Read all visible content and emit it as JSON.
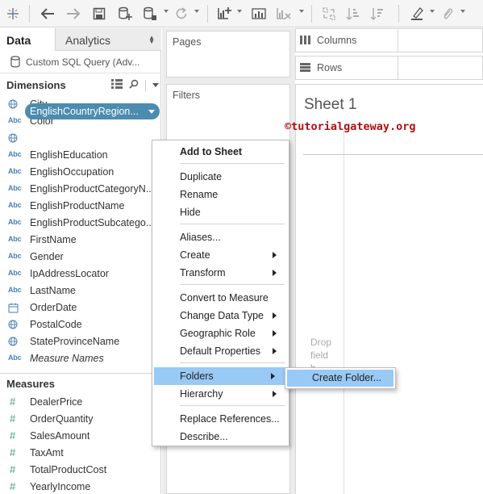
{
  "toolbar": {
    "buttons": [
      "tableau-logo-icon",
      "back-icon",
      "forward-icon",
      "save-icon",
      "new-datasource-icon",
      "datasource-icon",
      "refresh-icon",
      "new-worksheet-icon",
      "new-chart-icon",
      "clear-sheet-icon",
      "swap-icon",
      "sort-ascending-icon",
      "sort-descending-icon",
      "highlight-icon",
      "attach-icon"
    ]
  },
  "left_pane": {
    "tabs": {
      "data": "Data",
      "analytics": "Analytics"
    },
    "datasource": "Custom SQL Query (Adv...",
    "dimensions_header": "Dimensions",
    "dimensions": [
      {
        "type": "geo",
        "name": "City"
      },
      {
        "type": "Abc",
        "name": "Color"
      },
      {
        "type": "geo",
        "name": "EnglishCountryRegion...",
        "selected": true
      },
      {
        "type": "Abc",
        "name": "EnglishEducation"
      },
      {
        "type": "Abc",
        "name": "EnglishOccupation"
      },
      {
        "type": "Abc",
        "name": "EnglishProductCategoryN..."
      },
      {
        "type": "Abc",
        "name": "EnglishProductName"
      },
      {
        "type": "Abc",
        "name": "EnglishProductSubcatego..."
      },
      {
        "type": "Abc",
        "name": "FirstName"
      },
      {
        "type": "Abc",
        "name": "Gender"
      },
      {
        "type": "Abc",
        "name": "IpAddressLocator"
      },
      {
        "type": "Abc",
        "name": "LastName"
      },
      {
        "type": "date",
        "name": "OrderDate"
      },
      {
        "type": "geo",
        "name": "PostalCode"
      },
      {
        "type": "geo",
        "name": "StateProvinceName"
      },
      {
        "type": "Abc",
        "name": "Measure Names"
      }
    ],
    "measures_header": "Measures",
    "measures": [
      "DealerPrice",
      "OrderQuantity",
      "SalesAmount",
      "TaxAmt",
      "TotalProductCost",
      "YearlyIncome"
    ],
    "type_labels": {
      "abc": "Abc",
      "measure": "#"
    }
  },
  "cards": {
    "pages": "Pages",
    "filters": "Filters"
  },
  "shelves": {
    "columns": "Columns",
    "rows": "Rows"
  },
  "canvas": {
    "sheet_title": "Sheet 1",
    "watermark": "©tutorialgateway.org",
    "drop_hint_1": "Drop",
    "drop_hint_2": "field",
    "drop_hint_3": "h"
  },
  "context_menu": {
    "items": [
      "Add to Sheet",
      "Duplicate",
      "Rename",
      "Hide",
      "Aliases...",
      "Create",
      "Transform",
      "Convert to Measure",
      "Change Data Type",
      "Geographic Role",
      "Default Properties",
      "Folders",
      "Hierarchy",
      "Replace References...",
      "Describe..."
    ],
    "submenu_item": "Create Folder..."
  },
  "colors": {
    "pill": "#4b8cb0",
    "menu_highlight": "#99c9f5",
    "watermark": "#b01010",
    "dimension_icon": "#4a7fb5",
    "measure_icon": "#3b9e7a"
  }
}
